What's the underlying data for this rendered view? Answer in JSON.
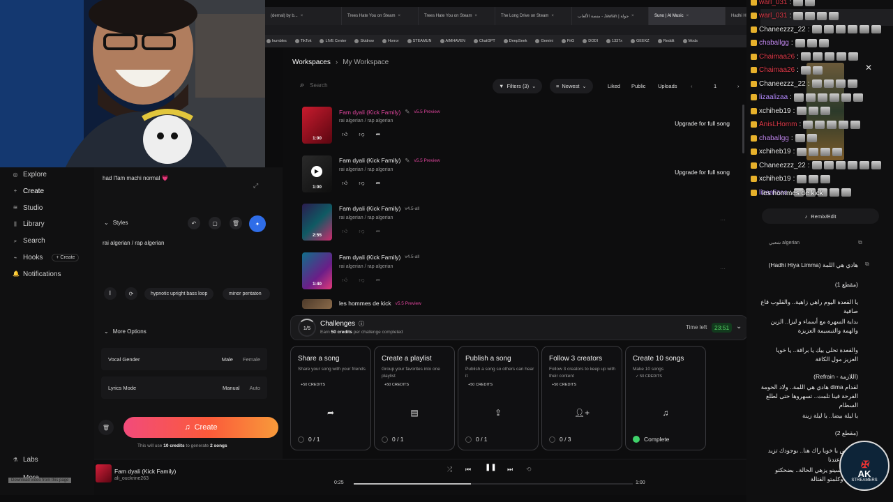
{
  "browser": {
    "tabs": [
      {
        "label": "(dernal) by b..."
      },
      {
        "label": "Trees Hate You on Steam"
      },
      {
        "label": "Trees Hate You on Steam"
      },
      {
        "label": "The Long Drive on Steam"
      },
      {
        "label": "منصة الألعاب - Jawlah | جولة"
      },
      {
        "label": "Suno | AI Music",
        "active": true
      },
      {
        "label": "Hadhi Hiya Limma - Goo..."
      }
    ],
    "bookmarks": [
      "humbles",
      "TikTok",
      "LIVE Center",
      "Skidrow",
      "Horror",
      "STEAMUN",
      "AIMHAVEN",
      "ChatGPT",
      "DeepSeek",
      "Gemini",
      "FitG",
      "DODI",
      "1337x",
      "GEEKZ",
      "Reddit",
      "Mods"
    ]
  },
  "sidebar": {
    "items": [
      {
        "label": "Explore",
        "icon": "compass-icon"
      },
      {
        "label": "Create",
        "icon": "plus-icon"
      },
      {
        "label": "Studio",
        "icon": "studio-icon"
      },
      {
        "label": "Library",
        "icon": "library-icon"
      },
      {
        "label": "Search",
        "icon": "search-icon"
      },
      {
        "label": "Hooks",
        "icon": "hooks-icon"
      },
      {
        "label": "Notifications",
        "icon": "bell-icon"
      }
    ],
    "hooks_create": "+ Create",
    "labs": "Labs",
    "more": "More",
    "download_overlay": "Download video from this page"
  },
  "create_panel": {
    "lyrics_text": "had l'fam machi normal 💗",
    "styles_label": "Styles",
    "styles_value": "rai algerian / rap algerian",
    "chips": [
      "hypnotic upright bass loop",
      "minor pentaton"
    ],
    "more_options": "More Options",
    "vocal_gender": {
      "label": "Vocal Gender",
      "a": "Male",
      "b": "Female"
    },
    "lyrics_mode": {
      "label": "Lyrics Mode",
      "a": "Manual",
      "b": "Auto"
    },
    "create_button": "Create",
    "credits_prefix": "This will use ",
    "credits_amount": "10 credits",
    "credits_mid": " to generate ",
    "credits_songs": "2 songs"
  },
  "main": {
    "breadcrumb": {
      "root": "Workspaces",
      "current": "My Workspace"
    },
    "search_placeholder": "Search",
    "filters": "Filters (3)",
    "sort": "Newest",
    "liked": "Liked",
    "public": "Public",
    "uploads": "Uploads",
    "page": "1",
    "songs": [
      {
        "title": "Fam dyali (Kick Family)",
        "version": "v5.5 Preview",
        "genre": "rai algerian / rap algerian",
        "duration": "1:00",
        "action": "Upgrade for full song",
        "pink": true
      },
      {
        "title": "Fam dyali (Kick Family)",
        "version": "v5.5 Preview",
        "genre": "rai algerian / rap algerian",
        "duration": "1:00",
        "action": "Upgrade for full song",
        "pink": false
      },
      {
        "title": "Fam dyali (Kick Family)",
        "version": "v4.5-all",
        "genre": "rai algerian / rap algerian",
        "duration": "2:55",
        "action": "···",
        "pink": false
      },
      {
        "title": "Fam dyali (Kick Family)",
        "version": "v4.5-all",
        "genre": "rai algerian / rap algerian",
        "duration": "1:40",
        "action": "···",
        "pink": false
      },
      {
        "title": "les hommes de kick",
        "version": "v5.5 Preview",
        "genre": "",
        "duration": "",
        "action": "",
        "pink": false
      }
    ],
    "challenges": {
      "progress": "1/5",
      "title": "Challenges",
      "subtitle_prefix": "Earn ",
      "subtitle_amount": "50 credits",
      "subtitle_suffix": " per challenge completed",
      "time_label": "Time left",
      "time_value": "23:51",
      "cards": [
        {
          "title": "Share a song",
          "desc": "Share your song with your friends",
          "credits": "+50 CREDITS",
          "progress": "0 / 1",
          "icon": "share-icon"
        },
        {
          "title": "Create a playlist",
          "desc": "Group your favorites into one playlist",
          "credits": "+50 CREDITS",
          "progress": "0 / 1",
          "icon": "playlist-icon"
        },
        {
          "title": "Publish a song",
          "desc": "Publish a song so others can hear it",
          "credits": "+50 CREDITS",
          "progress": "0 / 1",
          "icon": "upload-icon"
        },
        {
          "title": "Follow 3 creators",
          "desc": "Follow 3 creators to keep up with their content",
          "credits": "+50 CREDITS",
          "progress": "0 / 3",
          "icon": "follow-icon"
        },
        {
          "title": "Create 10 songs",
          "desc": "Make 10 songs",
          "credits": "✓ 50 CREDITS",
          "progress": "Complete",
          "icon": "music-note-icon"
        }
      ]
    }
  },
  "player": {
    "title": "Fam dyali (Kick Family)",
    "artist": "ali_ouckrine263",
    "time_current": "0:25",
    "time_total": "1:00",
    "progress_fraction": 0.42
  },
  "chat": [
    {
      "user": "warl_031",
      "color": "#e33b4a"
    },
    {
      "user": "warl_031",
      "color": "#e33b4a"
    },
    {
      "user": "Chaneezzz_22",
      "color": "#e6e6e6"
    },
    {
      "user": "chaballgg",
      "color": "#c58bf3"
    },
    {
      "user": "Chaimaa26",
      "color": "#e33b4a"
    },
    {
      "user": "Chaimaa26",
      "color": "#e33b4a"
    },
    {
      "user": "Chaneezzz_22",
      "color": "#e6e6e6"
    },
    {
      "user": "lizaalizaa",
      "color": "#b68cff"
    },
    {
      "user": "xchiheb19",
      "color": "#e6e6e6"
    },
    {
      "user": "AnisLHomm",
      "color": "#e33b4a"
    },
    {
      "user": "chaballgg",
      "color": "#c58bf3"
    },
    {
      "user": "xchiheb19",
      "color": "#e6e6e6"
    },
    {
      "user": "Chaneezzz_22",
      "color": "#e6e6e6"
    },
    {
      "user": "xchiheb19",
      "color": "#e6e6e6"
    },
    {
      "user": "lizaalizaa",
      "color": "#b68cff"
    }
  ],
  "chat_message": "les hommes de kick",
  "lyrics_panel": {
    "remix": "Remix/Edit",
    "style": "شعبي algerian",
    "lines": [
      "هادي هي اللمة (Hadhi Hiya Limma)",
      "(مقطع 1)",
      "يا القعدة اليوم راهي زاهية.. والقلوب قاع صافية",
      "بداية السهرة مع أسماء و ليزا.. الزين والهمة والتبسيمة العزيزة",
      "والقعدة تحلى بيك يا برافة.. يا خويا العزيز مول الكافة",
      "(اللازمة - Refrain)",
      "لقدام dima هادي هي اللمة.. ولاد الحومة الفرحة فينا تلمت.. تسهروها حتى لطلع السطام",
      "يا ليلة بيضا.. يا ليلة زينة",
      "(مقطع 2)",
      "يا رياض يا خويا راك هنا.. بوجودك تزيد الفرحة عندنا",
      "جيبولنا سينو يزهي الحالة.. بضحكتو الزينة وكلمتو القتالة"
    ]
  },
  "logo": {
    "line1": "AK",
    "line2": "STREAMERS"
  }
}
